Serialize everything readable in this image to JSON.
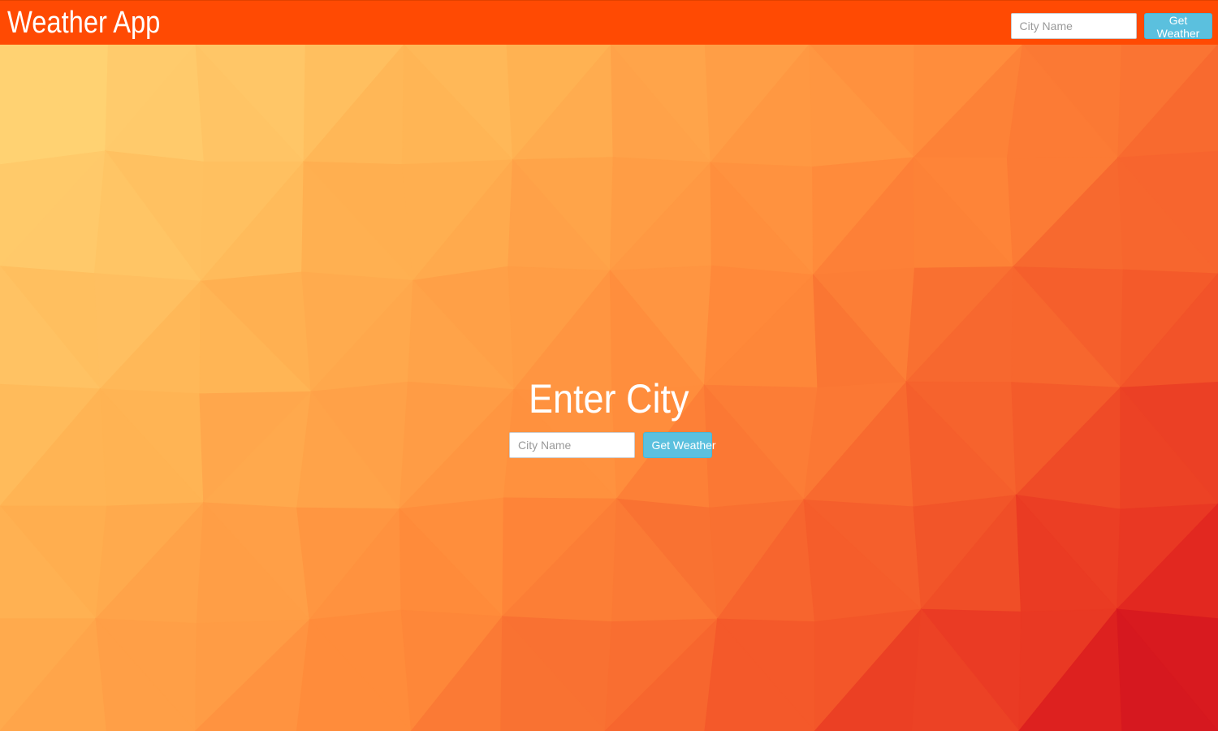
{
  "app": {
    "title": "Weather App"
  },
  "navbar": {
    "search": {
      "placeholder": "City Name",
      "button_label": "Get Weather"
    },
    "background_color": "#ff4a03"
  },
  "main": {
    "heading": "Enter City",
    "search": {
      "placeholder": "City Name",
      "button_label": "Get Weather"
    }
  },
  "colors": {
    "button": "#5bc0de",
    "background_top_left": "#ffd97a",
    "background_bottom_right": "#d21220"
  }
}
